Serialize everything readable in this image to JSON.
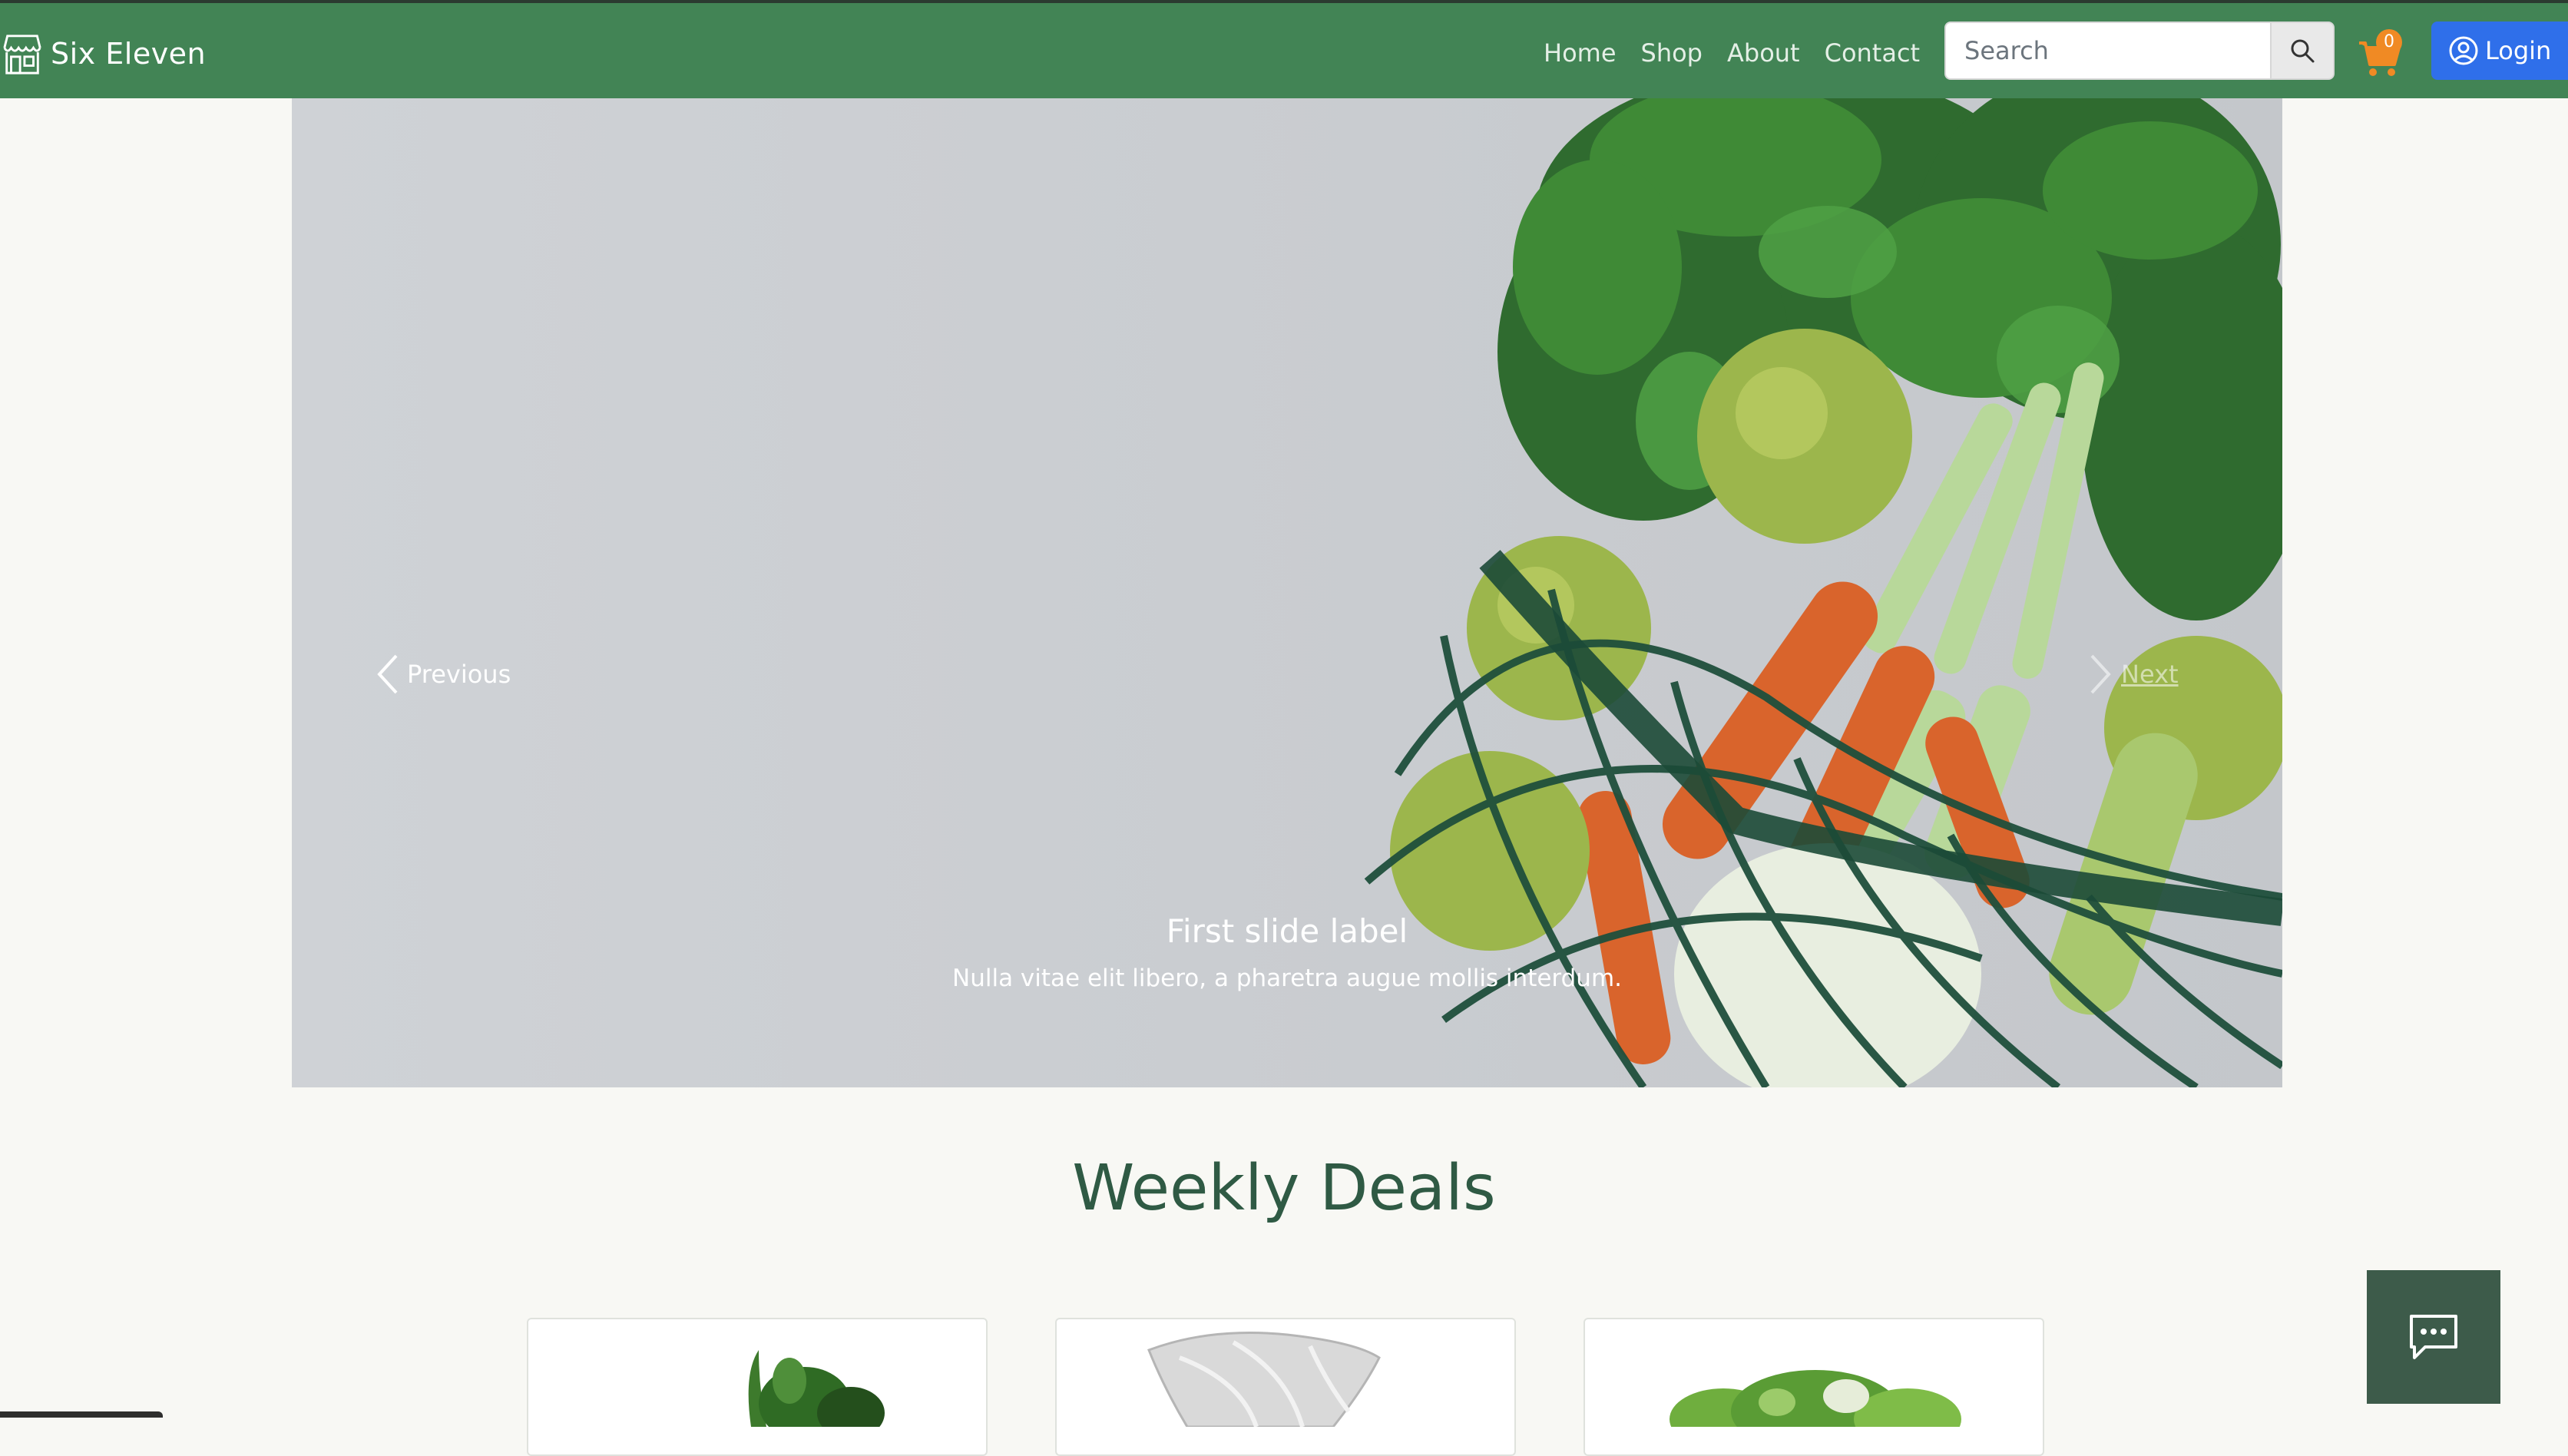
{
  "navbar": {
    "brand": "Six Eleven",
    "links": [
      {
        "label": "Home"
      },
      {
        "label": "Shop"
      },
      {
        "label": "About"
      },
      {
        "label": "Contact"
      }
    ],
    "search": {
      "placeholder": "Search",
      "value": ""
    },
    "cart_count": "0",
    "login_label": "Login",
    "icons": {
      "brand": "storefront-icon",
      "search": "search-icon",
      "cart": "shopping-cart-icon",
      "login": "user-circle-icon"
    }
  },
  "carousel": {
    "prev_label": "Previous",
    "next_label": "Next",
    "caption_title": "First slide label",
    "caption_text": "Nulla vitae elit libero, a pharetra augue mollis interdum."
  },
  "deals": {
    "title": "Weekly Deals",
    "card_count": 3
  },
  "chat": {
    "icon": "chat-bubble-icon"
  },
  "colors": {
    "navbar": "#428455",
    "page_bg": "#f8f8f4",
    "login_button": "#2f6fea",
    "cart_badge": "#f08a24",
    "chat_button": "#3d5b4a",
    "section_title": "#2f5a44"
  }
}
